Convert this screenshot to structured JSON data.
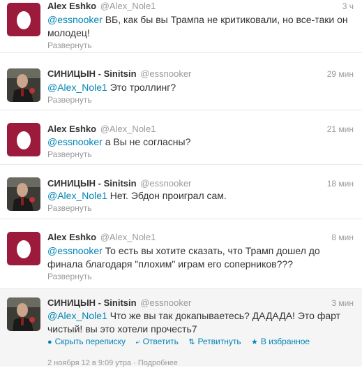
{
  "tweets": [
    {
      "fullname": "Alex Eshko",
      "username": "@Alex_Nole1",
      "time": "3 ч",
      "mention": "@essnooker",
      "text": " ВБ, как бы вы Трампа не критиковали, но все-таки он молодец!",
      "expand": "Развернуть",
      "avatar": "egg-avatar"
    },
    {
      "fullname": "СИНИЦЫН - Sinitsin",
      "username": "@essnooker",
      "time": "29 мин",
      "mention": "@Alex_Nole1",
      "text": " Это троллинг?",
      "expand": "Развернуть",
      "avatar": "photo-avatar"
    },
    {
      "fullname": "Alex Eshko",
      "username": "@Alex_Nole1",
      "time": "21 мин",
      "mention": "@essnooker",
      "text": " а Вы не согласны?",
      "expand": "Развернуть",
      "avatar": "egg-avatar"
    },
    {
      "fullname": "СИНИЦЫН - Sinitsin",
      "username": "@essnooker",
      "time": "18 мин",
      "mention": "@Alex_Nole1",
      "text": " Нет. Эбдон проиграл сам.",
      "expand": "Развернуть",
      "avatar": "photo-avatar"
    },
    {
      "fullname": "Alex Eshko",
      "username": "@Alex_Nole1",
      "time": "8 мин",
      "mention": "@essnooker",
      "text": " То есть вы хотите сказать, что Трамп дошел до финала благодаря \"плохим\" играм его соперников???",
      "expand": "Развернуть",
      "avatar": "egg-avatar"
    },
    {
      "fullname": "СИНИЦЫН - Sinitsin",
      "username": "@essnooker",
      "time": "3 мин",
      "mention": "@Alex_Nole1",
      "text": " Что же вы так докапываетесь? ДАДАДА! Это фарт чистый! вы это хотели прочесть7",
      "avatar": "photo-avatar",
      "actions": {
        "hide_conversation": "Скрыть переписку",
        "reply": "Ответить",
        "retweet": "Ретвитнуть",
        "favorite": "В избранное"
      },
      "meta": {
        "date": "2 ноября 12 в 9:09 утра",
        "separator": "·",
        "details": "Подробнее"
      }
    }
  ],
  "colors": {
    "link": "#0084b4",
    "muted": "#999999",
    "egg_bg": "#9c1a3b"
  }
}
